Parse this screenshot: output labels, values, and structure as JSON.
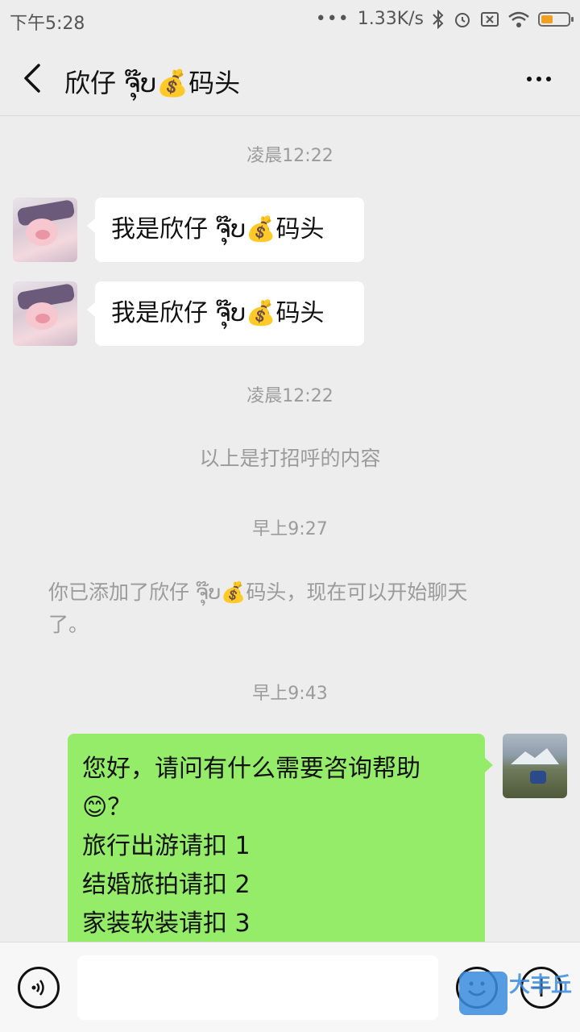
{
  "status_bar": {
    "time": "下午5:28",
    "speed": "1.33K/s",
    "icons": [
      "more-dots-icon",
      "bluetooth-icon",
      "alarm-icon",
      "sim-icon",
      "wifi-icon",
      "battery-icon"
    ],
    "battery_color": "#f0a020"
  },
  "header": {
    "title": "欣仔 ຈຸ໊ບ💰码头",
    "back_icon": "back-icon",
    "more_icon": "more-icon"
  },
  "chat": {
    "timestamps": [
      "凌晨12:22",
      "凌晨12:22",
      "早上9:27",
      "早上9:43"
    ],
    "incoming": [
      {
        "text": "我是欣仔 ຈຸ໊ບ💰码头",
        "avatar": "pig-avatar"
      },
      {
        "text": "我是欣仔 ຈຸ໊ບ💰码头",
        "avatar": "pig-avatar"
      }
    ],
    "system": {
      "greeting_note": "以上是打招呼的内容",
      "added_line1": "你已添加了欣仔 ຈຸ໊ບ💰码头，现在可以开始聊天",
      "added_line2": "了。"
    },
    "outgoing": {
      "avatar": "mountain-avatar",
      "lines": [
        "您好，请问有什么需要咨询帮助",
        "😊？",
        "旅行出游请扣 1",
        "结婚旅拍请扣 2",
        "家装软装请扣 3"
      ]
    }
  },
  "input_bar": {
    "placeholder": "",
    "voice_icon": "voice-icon",
    "emoji_icon": "emoji-icon",
    "plus_icon": "plus-icon",
    "plus_label": "+"
  },
  "watermark": {
    "text": "大丰丘"
  },
  "colors": {
    "background": "#ededed",
    "incoming_bubble": "#ffffff",
    "outgoing_bubble": "#95ec69",
    "meta_text": "#9b9b9b"
  }
}
